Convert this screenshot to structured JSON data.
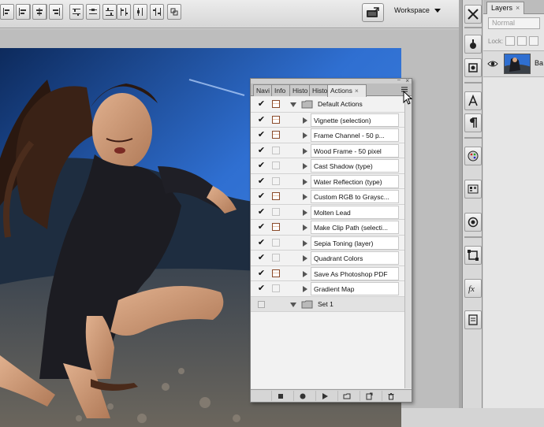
{
  "toolbar": {
    "workspace_label": "Workspace"
  },
  "layers_panel": {
    "tab_label": "Layers",
    "blend_mode": "Normal",
    "lock_label": "Lock:",
    "layer_name": "Ba"
  },
  "actions_panel": {
    "tabs": [
      {
        "label": "Navi"
      },
      {
        "label": "Info"
      },
      {
        "label": "Histo"
      },
      {
        "label": "Histo"
      },
      {
        "label": "Actions"
      }
    ],
    "default_set_name": "Default Actions",
    "actions": [
      {
        "name": "Vignette (selection)",
        "checked": true,
        "dialog": true
      },
      {
        "name": "Frame Channel - 50 p...",
        "checked": true,
        "dialog": true
      },
      {
        "name": "Wood Frame - 50 pixel",
        "checked": true,
        "dialog": false
      },
      {
        "name": "Cast Shadow (type)",
        "checked": true,
        "dialog": false
      },
      {
        "name": "Water Reflection (type)",
        "checked": true,
        "dialog": false
      },
      {
        "name": "Custom RGB to Graysc...",
        "checked": true,
        "dialog": true
      },
      {
        "name": "Molten Lead",
        "checked": true,
        "dialog": false
      },
      {
        "name": "Make Clip Path (selecti...",
        "checked": true,
        "dialog": true
      },
      {
        "name": "Sepia Toning (layer)",
        "checked": true,
        "dialog": false
      },
      {
        "name": "Quadrant Colors",
        "checked": true,
        "dialog": false
      },
      {
        "name": "Save As Photoshop PDF",
        "checked": true,
        "dialog": true
      },
      {
        "name": "Gradient Map",
        "checked": true,
        "dialog": false
      }
    ],
    "second_set_name": "Set 1"
  },
  "colors": {
    "sky": "#2f6fd1",
    "panel_bg": "#e8e8e8",
    "dialog_icon": "#d38a5a"
  }
}
